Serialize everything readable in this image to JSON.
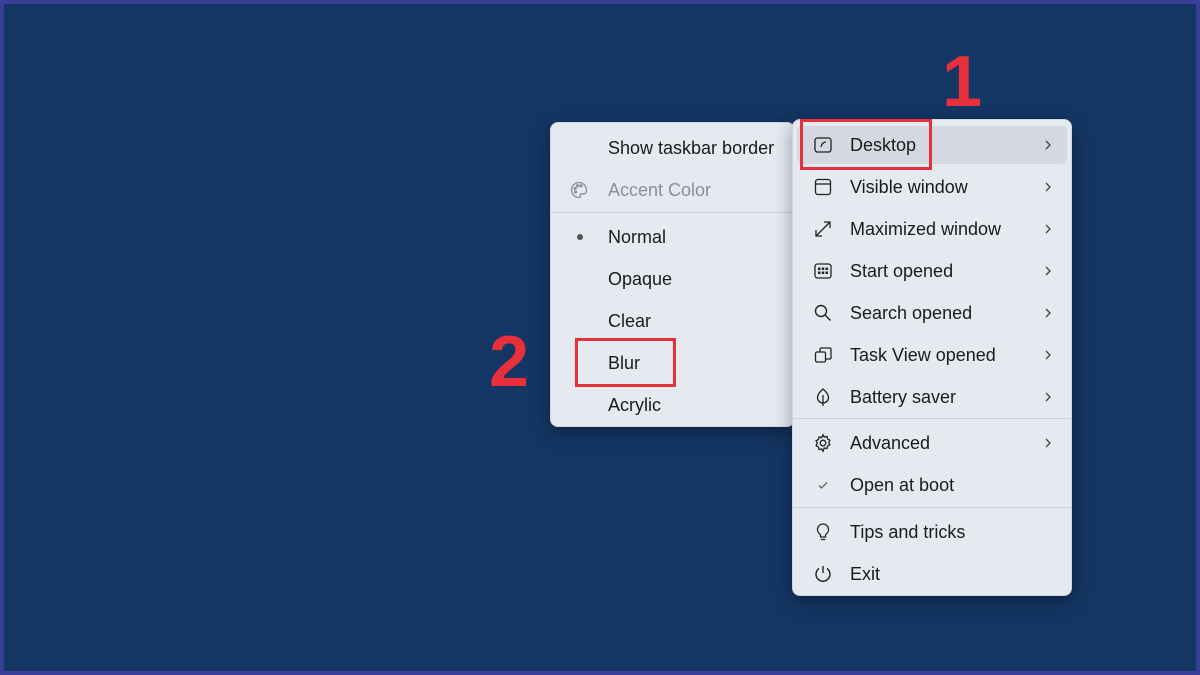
{
  "submenu": {
    "items": [
      {
        "label": "Show taskbar border"
      },
      {
        "label": "Accent Color",
        "icon": "palette-icon",
        "disabled": true
      },
      {
        "label": "Normal",
        "selected": true
      },
      {
        "label": "Opaque"
      },
      {
        "label": "Clear"
      },
      {
        "label": "Blur"
      },
      {
        "label": "Acrylic"
      }
    ]
  },
  "main_menu": {
    "items": [
      {
        "label": "Desktop",
        "icon": "desktop-icon",
        "submenu": true
      },
      {
        "label": "Visible window",
        "icon": "window-icon",
        "submenu": true
      },
      {
        "label": "Maximized window",
        "icon": "maximize-icon",
        "submenu": true
      },
      {
        "label": "Start opened",
        "icon": "start-icon",
        "submenu": true
      },
      {
        "label": "Search opened",
        "icon": "search-icon",
        "submenu": true
      },
      {
        "label": "Task View opened",
        "icon": "task-view-icon",
        "submenu": true
      },
      {
        "label": "Battery saver",
        "icon": "leaf-icon",
        "submenu": true
      },
      {
        "label": "Advanced",
        "icon": "gear-icon",
        "submenu": true
      },
      {
        "label": "Open at boot",
        "icon": "checkmark-icon",
        "checked": true
      },
      {
        "label": "Tips and tricks",
        "icon": "lightbulb-icon"
      },
      {
        "label": "Exit",
        "icon": "power-icon"
      }
    ]
  },
  "annotations": {
    "step1": "1",
    "step2": "2"
  },
  "colors": {
    "background": "#143664",
    "frame": "#3a3f96",
    "menu": "#e5e9f0",
    "highlight": "#e8303a"
  }
}
